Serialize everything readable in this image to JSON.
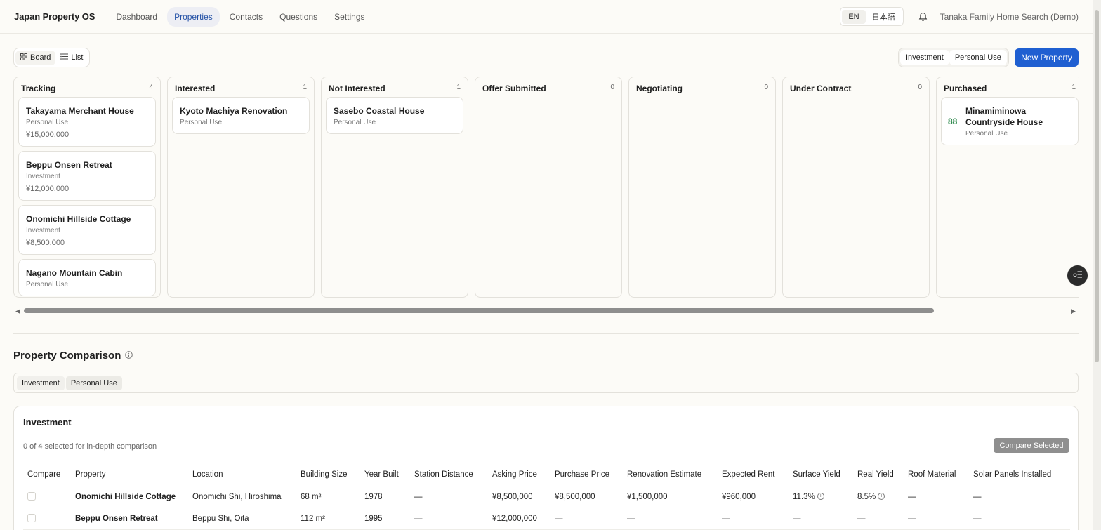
{
  "nav": {
    "brand": "Japan Property OS",
    "links": [
      "Dashboard",
      "Properties",
      "Contacts",
      "Questions",
      "Settings"
    ],
    "active": "Properties",
    "lang_en": "EN",
    "lang_ja": "日本語",
    "workspace": "Tanaka Family Home Search (Demo)"
  },
  "controls": {
    "board": "Board",
    "list": "List",
    "investment": "Investment",
    "personal_use": "Personal Use",
    "new_property": "New Property"
  },
  "board": {
    "columns": [
      {
        "title": "Tracking",
        "count": "4",
        "cards": [
          {
            "title": "Takayama Merchant House",
            "use": "Personal Use",
            "price": "¥15,000,000"
          },
          {
            "title": "Beppu Onsen Retreat",
            "use": "Investment",
            "price": "¥12,000,000"
          },
          {
            "title": "Onomichi Hillside Cottage",
            "use": "Investment",
            "price": "¥8,500,000"
          },
          {
            "title": "Nagano Mountain Cabin",
            "use": "Personal Use"
          }
        ]
      },
      {
        "title": "Interested",
        "count": "1",
        "cards": [
          {
            "title": "Kyoto Machiya Renovation",
            "use": "Personal Use"
          }
        ]
      },
      {
        "title": "Not Interested",
        "count": "1",
        "cards": [
          {
            "title": "Sasebo Coastal House",
            "use": "Personal Use"
          }
        ]
      },
      {
        "title": "Offer Submitted",
        "count": "0",
        "cards": []
      },
      {
        "title": "Negotiating",
        "count": "0",
        "cards": []
      },
      {
        "title": "Under Contract",
        "count": "0",
        "cards": []
      },
      {
        "title": "Purchased",
        "count": "1",
        "cards": [
          {
            "title": "Minamiminowa Countryside House",
            "use": "Personal Use",
            "score": "88"
          }
        ]
      }
    ]
  },
  "comparison": {
    "title": "Property Comparison",
    "tabs": [
      "Investment",
      "Personal Use"
    ],
    "section_title": "Investment",
    "selected_text": "0 of 4 selected for in-depth comparison",
    "compare_button": "Compare Selected",
    "headers": [
      "Compare",
      "Property",
      "Location",
      "Building Size",
      "Year Built",
      "Station Distance",
      "Asking Price",
      "Purchase Price",
      "Renovation Estimate",
      "Expected Rent",
      "Surface Yield",
      "Real Yield",
      "Roof Material",
      "Solar Panels Installed"
    ],
    "rows": [
      {
        "property": "Onomichi Hillside Cottage",
        "location": "Onomichi Shi, Hiroshima",
        "size": "68 m²",
        "year": "1978",
        "station": "—",
        "asking": "¥8,500,000",
        "purchase": "¥8,500,000",
        "renovation": "¥1,500,000",
        "rent": "¥960,000",
        "surface": "11.3%",
        "real": "8.5%",
        "roof": "—",
        "solar": "—"
      },
      {
        "property": "Beppu Onsen Retreat",
        "location": "Beppu Shi, Oita",
        "size": "112 m²",
        "year": "1995",
        "station": "—",
        "asking": "¥12,000,000",
        "purchase": "—",
        "renovation": "—",
        "rent": "—",
        "surface": "—",
        "real": "—",
        "roof": "—",
        "solar": "—"
      }
    ]
  }
}
